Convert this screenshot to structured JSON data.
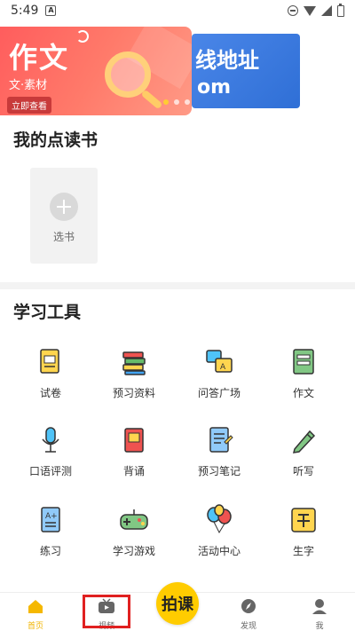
{
  "status_bar": {
    "time": "5:49",
    "a_badge": "A"
  },
  "banner": {
    "main_title": "作文",
    "main_sub": "文·素材",
    "main_cta": "立即查看",
    "right_title": "线地址",
    "right_sub": "om"
  },
  "my_books": {
    "title": "我的点读书",
    "add_label": "选书"
  },
  "tools": {
    "title": "学习工具",
    "items": [
      {
        "label": "试卷",
        "icon": "exam-paper-icon"
      },
      {
        "label": "预习资料",
        "icon": "book-stack-icon"
      },
      {
        "label": "问答广场",
        "icon": "qa-icon"
      },
      {
        "label": "作文",
        "icon": "composition-book-icon"
      },
      {
        "label": "口语评测",
        "icon": "microphone-icon"
      },
      {
        "label": "背诵",
        "icon": "recite-book-icon"
      },
      {
        "label": "预习笔记",
        "icon": "notebook-icon"
      },
      {
        "label": "听写",
        "icon": "pencil-icon"
      },
      {
        "label": "练习",
        "icon": "practice-sheet-icon"
      },
      {
        "label": "学习游戏",
        "icon": "gamepad-icon"
      },
      {
        "label": "活动中心",
        "icon": "balloons-icon"
      },
      {
        "label": "生字",
        "icon": "character-card-icon"
      }
    ]
  },
  "bottom_nav": {
    "home": "首页",
    "video": "视频",
    "center": "拍课",
    "discover": "发现",
    "me": "我"
  }
}
